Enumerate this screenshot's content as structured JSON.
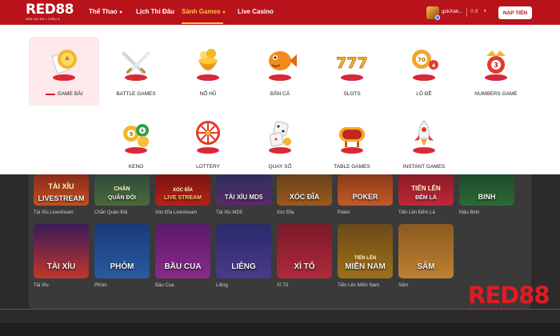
{
  "brand": {
    "logo": "RED88",
    "logo_sub": "NHÀ CÁI SỐ 1 CHÂU Á"
  },
  "nav": [
    {
      "label": "Thể Thao",
      "chevron": true
    },
    {
      "label": "Lịch Thi Đấu",
      "chevron": false
    },
    {
      "label": "Sảnh Games",
      "chevron": true,
      "active": true
    },
    {
      "label": "Live Casino",
      "chevron": false
    }
  ],
  "user": {
    "name": "gckXek...",
    "balance": "0 đ",
    "deposit_label": "NẠP TIỀN"
  },
  "accent_colors": {
    "primary_red": "#b8121b",
    "active_gold": "#ffc23d"
  },
  "dropdown": {
    "items": [
      {
        "label": "GAME BÀI",
        "icon": "game-bai-icon",
        "selected": true
      },
      {
        "label": "BATTLE GAMES",
        "icon": "battle-games-icon"
      },
      {
        "label": "NỔ HŨ",
        "icon": "no-hu-icon"
      },
      {
        "label": "BẮN CÁ",
        "icon": "ban-ca-icon"
      },
      {
        "label": "SLOTS",
        "icon": "slots-icon"
      },
      {
        "label": "LÔ ĐỀ",
        "icon": "lo-de-icon"
      },
      {
        "label": "NUMBERS GAME",
        "icon": "numbers-game-icon"
      },
      {
        "label": "KENO",
        "icon": "keno-icon"
      },
      {
        "label": "LOTTERY",
        "icon": "lottery-icon"
      },
      {
        "label": "QUAY SỐ",
        "icon": "quay-so-icon"
      },
      {
        "label": "TABLE GAMES",
        "icon": "table-games-icon"
      },
      {
        "label": "INSTANT GAMES",
        "icon": "instant-games-icon"
      }
    ]
  },
  "games_row1": [
    {
      "name": "Tài Xỉu Livestream",
      "thumb": "TÀI XỈU",
      "thumb2": "LIVESTREAM"
    },
    {
      "name": "Chắn Quân Đội",
      "thumb": "CHẮN",
      "thumb2": "QUÂN ĐỘI"
    },
    {
      "name": "Xóc Đĩa Livestream",
      "thumb": "XÓC ĐĨA",
      "thumb2": "LIVE STREAM"
    },
    {
      "name": "Tài Xỉu MD5",
      "thumb": "TÀI XỈU MD5",
      "thumb2": ""
    },
    {
      "name": "Xóc Đĩa",
      "thumb": "XÓC ĐĨA",
      "thumb2": ""
    },
    {
      "name": "Poker",
      "thumb": "POKER",
      "thumb2": ""
    },
    {
      "name": "Tiến Lên Đếm Lá",
      "thumb": "TIẾN LÊN",
      "thumb2": "ĐẾM LÁ"
    },
    {
      "name": "Mậu Binh",
      "thumb": "BINH",
      "thumb2": ""
    }
  ],
  "games_row2": [
    {
      "name": "Tài Xỉu",
      "thumb": "TÀI XỈU",
      "thumb2": ""
    },
    {
      "name": "Phỏm",
      "thumb": "PHỎM",
      "thumb2": ""
    },
    {
      "name": "Bầu Cua",
      "thumb": "BẦU CUA",
      "thumb2": ""
    },
    {
      "name": "Liêng",
      "thumb": "LIÊNG",
      "thumb2": ""
    },
    {
      "name": "Xì Tố",
      "thumb": "XÌ TỐ",
      "thumb2": ""
    },
    {
      "name": "Tiến Lên Miền Nam",
      "thumb": "MIỀN NAM",
      "thumb2": "TIẾN LÊN"
    },
    {
      "name": "Sâm",
      "thumb": "SÂM",
      "thumb2": ""
    }
  ],
  "watermark": {
    "text": "RED88",
    "sub": "NHÀ CÁI SỐ 1 CHÂU Á"
  }
}
